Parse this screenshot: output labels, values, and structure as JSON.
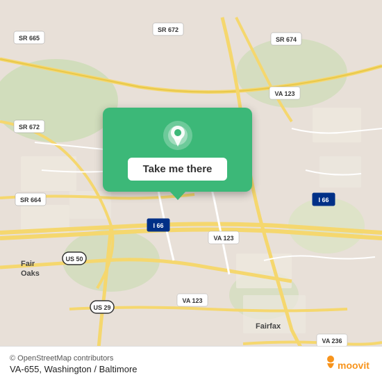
{
  "map": {
    "background_color": "#e8e0d8",
    "center_lat": 38.85,
    "center_lng": -77.35
  },
  "popup": {
    "button_label": "Take me there",
    "background_color": "#3cb878"
  },
  "bottom_bar": {
    "copyright": "© OpenStreetMap contributors",
    "location_label": "VA-655, Washington / Baltimore",
    "moovit_text": "moovit"
  },
  "road_labels": [
    {
      "id": "sr665",
      "text": "SR 665"
    },
    {
      "id": "sr672_top",
      "text": "SR 672"
    },
    {
      "id": "sr672_left",
      "text": "SR 672"
    },
    {
      "id": "sr674",
      "text": "SR 674"
    },
    {
      "id": "va123_top",
      "text": "VA 123"
    },
    {
      "id": "sr664",
      "text": "SR 664"
    },
    {
      "id": "i66",
      "text": "I 66"
    },
    {
      "id": "va123_mid",
      "text": "VA 123"
    },
    {
      "id": "us50",
      "text": "US 50"
    },
    {
      "id": "us29",
      "text": "US 29"
    },
    {
      "id": "va123_bot",
      "text": "VA 123"
    },
    {
      "id": "va236",
      "text": "VA 236"
    },
    {
      "id": "fair_oaks",
      "text": "Fair\nOaks"
    },
    {
      "id": "fairfax",
      "text": "Fairfax"
    }
  ]
}
